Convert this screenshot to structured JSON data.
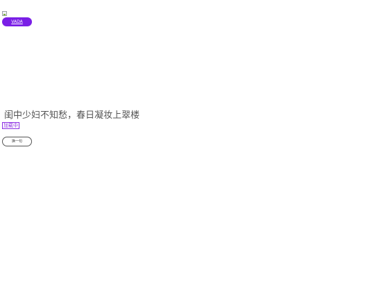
{
  "header": {
    "brand_button_label": "VADA"
  },
  "main": {
    "poem_line": "闺中少妇不知愁，春日凝妆上翠楼",
    "loading_label": "加载中",
    "action_button_label": "换一句"
  },
  "colors": {
    "brand_button_bg": "#7a1fe6",
    "loading_tag": "#8a2be2"
  },
  "icons": {
    "logo": "broken-image-icon"
  }
}
